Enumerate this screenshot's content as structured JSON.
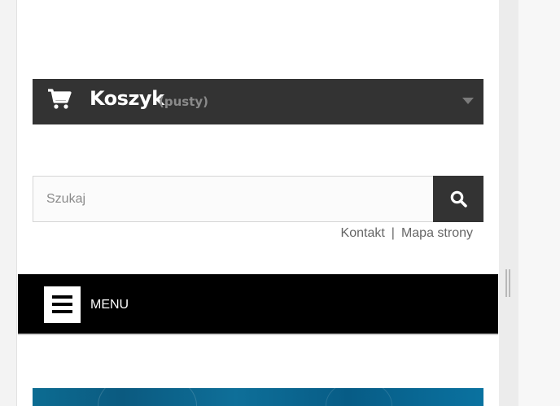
{
  "cart": {
    "title": "Koszyk",
    "status": "(pusty)",
    "icon": "cart-icon"
  },
  "search": {
    "placeholder": "Szukaj",
    "value": "",
    "icon": "search-icon"
  },
  "links": {
    "contact": "Kontakt",
    "separator": "|",
    "sitemap": "Mapa strony"
  },
  "menu": {
    "label": "MENU",
    "icon": "hamburger-icon"
  },
  "colors": {
    "cart_bar": "#333333",
    "menu_bar": "#000000",
    "banner": "#0b5f88"
  }
}
